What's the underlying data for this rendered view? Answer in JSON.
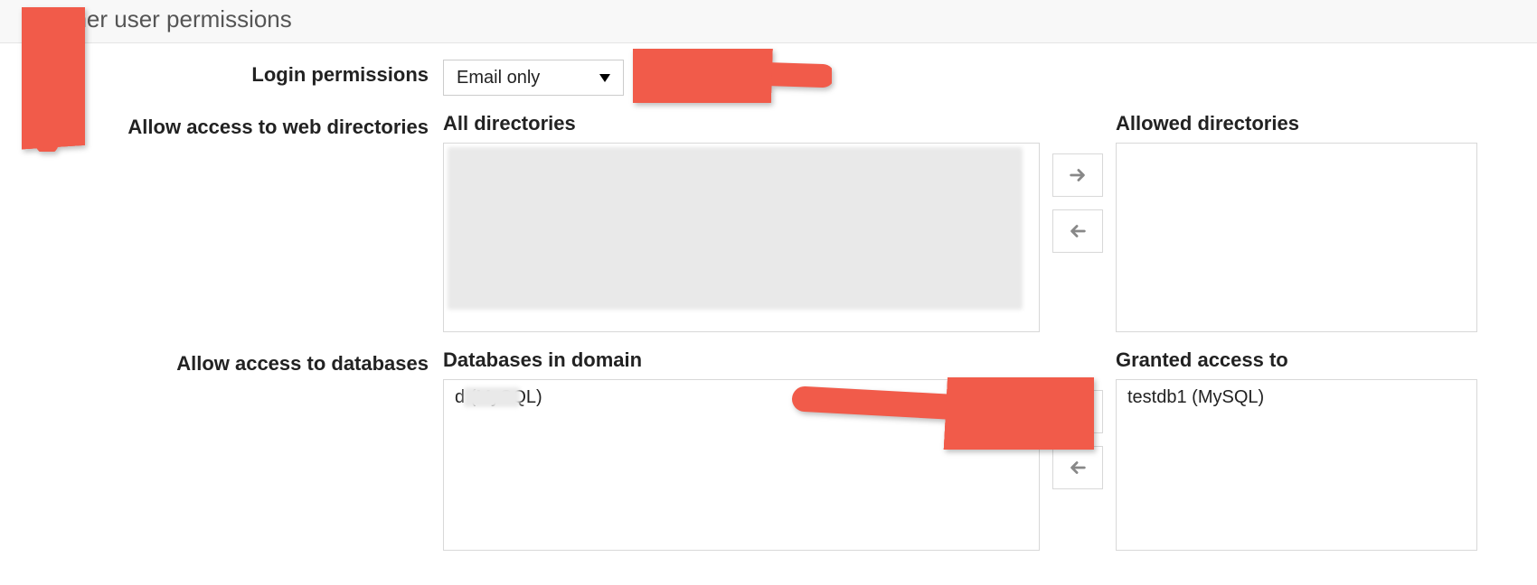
{
  "section_title": "Other user permissions",
  "login_permissions": {
    "label": "Login permissions",
    "value": "Email only"
  },
  "web_dirs": {
    "label": "Allow access to web directories",
    "all_heading": "All directories",
    "allowed_heading": "Allowed directories",
    "all_items": [],
    "allowed_items": []
  },
  "databases": {
    "label": "Allow access to databases",
    "domain_heading": "Databases in domain",
    "granted_heading": "Granted access to",
    "domain_items": [
      "d          (MySQL)"
    ],
    "granted_items": [
      "testdb1 (MySQL)"
    ]
  }
}
